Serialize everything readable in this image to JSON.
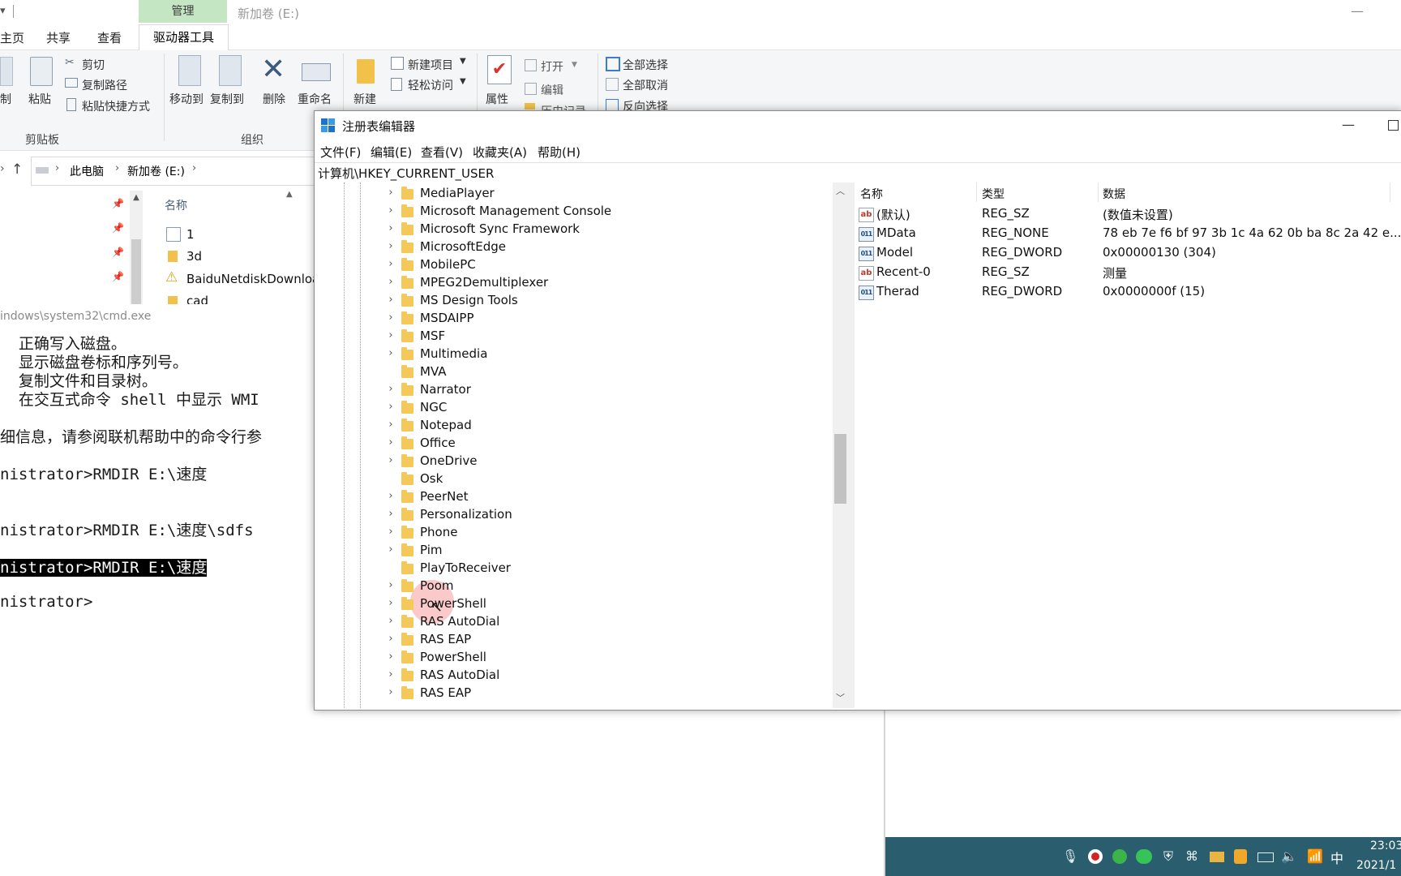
{
  "explorer": {
    "title": "新加卷 (E:)",
    "manage_tab": "管理",
    "tabs": [
      "主页",
      "共享",
      "查看"
    ],
    "active_tab": "驱动器工具",
    "ribbon": {
      "copy_label": "制",
      "paste_label": "粘贴",
      "cut_label": "剪切",
      "copy_path_label": "复制路径",
      "paste_shortcut_label": "粘贴快捷方式",
      "clipboard_group": "剪贴板",
      "move_to_label": "移动到",
      "copy_to_label": "复制到",
      "delete_label": "删除",
      "rename_label": "重命名",
      "organize_group": "组织",
      "new_label": "新建",
      "new_item_label": "新建项目",
      "easy_access_label": "轻松访问",
      "properties_label": "属性",
      "open_label": "打开",
      "edit_label": "编辑",
      "history_label": "历史记录",
      "select_all_label": "全部选择",
      "select_none_label": "全部取消",
      "invert_label": "反向选择"
    },
    "breadcrumb": [
      "此电脑",
      "新加卷 (E:)"
    ],
    "column_name": "名称",
    "files": [
      {
        "name": "1",
        "kind": "list"
      },
      {
        "name": "3d",
        "kind": "folder"
      },
      {
        "name": "BaiduNetdiskDownloa",
        "kind": "warning"
      },
      {
        "name": "cad",
        "kind": "folder"
      }
    ]
  },
  "cmd": {
    "title": "indows\\system32\\cmd.exe",
    "lines": [
      "  正确写入磁盘。",
      "  显示磁盘卷标和序列号。",
      "  复制文件和目录树。",
      "  在交互式命令 shell 中显示 WMI",
      "",
      "细信息，请参阅联机帮助中的命令行参",
      "",
      "nistrator>RMDIR E:\\速度",
      "",
      "",
      "nistrator>RMDIR E:\\速度\\sdfs",
      "",
      "nistrator>RMDIR E:\\速度",
      "",
      "nistrator>"
    ],
    "highlight_line": 12
  },
  "regedit": {
    "title": "注册表编辑器",
    "menu": [
      "文件(F)",
      "编辑(E)",
      "查看(V)",
      "收藏夹(A)",
      "帮助(H)"
    ],
    "address": "计算机\\HKEY_CURRENT_USER",
    "tree_items": [
      "MediaPlayer",
      "Microsoft Management Console",
      "Microsoft Sync Framework",
      "MicrosoftEdge",
      "MobilePC",
      "MPEG2Demultiplexer",
      "MS Design Tools",
      "MSDAIPP",
      "MSF",
      "Multimedia",
      "MVA",
      "Narrator",
      "NGC",
      "Notepad",
      "Office",
      "OneDrive",
      "Osk",
      "PeerNet",
      "Personalization",
      "Phone",
      "Pim",
      "PlayToReceiver",
      "Poom",
      "PowerShell",
      "RAS AutoDial",
      "RAS EAP",
      "PowerShell",
      "RAS AutoDial",
      "RAS EAP"
    ],
    "no_chevron": [
      "MVA",
      "Osk",
      "PlayToReceiver"
    ],
    "columns": {
      "name": "名称",
      "type": "类型",
      "data": "数据"
    },
    "values": [
      {
        "name": "(默认)",
        "type": "REG_SZ",
        "data": "(数值未设置)",
        "icon": "ab"
      },
      {
        "name": "MData",
        "type": "REG_NONE",
        "data": "78 eb 7e f6 bf 97 3b 1c 4a 62 0b ba 8c 2a 42 e...",
        "icon": "bin"
      },
      {
        "name": "Model",
        "type": "REG_DWORD",
        "data": "0x00000130 (304)",
        "icon": "bin"
      },
      {
        "name": "Recent-0",
        "type": "REG_SZ",
        "data": "测量",
        "icon": "ab"
      },
      {
        "name": "Therad",
        "type": "REG_DWORD",
        "data": "0x0000000f (15)",
        "icon": "bin"
      }
    ]
  },
  "taskbar": {
    "ime": "中",
    "time": "23:03",
    "date": "2021/1"
  }
}
